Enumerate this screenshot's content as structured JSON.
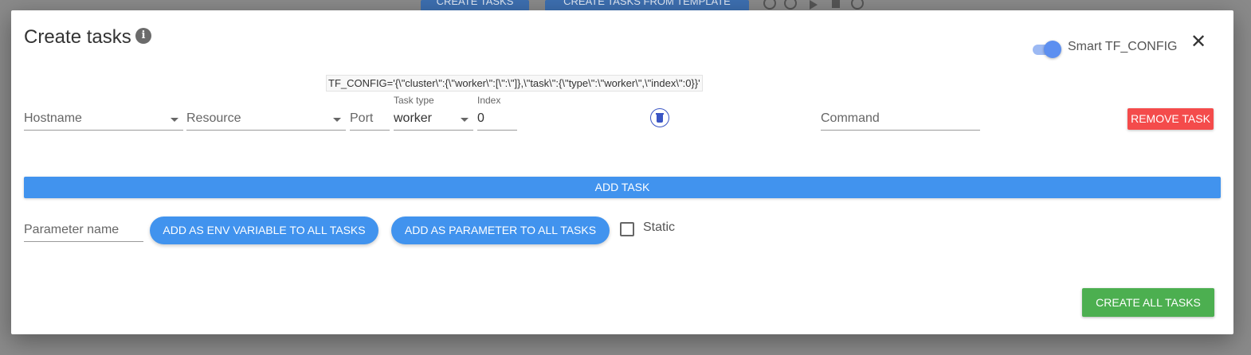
{
  "background": {
    "create_tasks_label": "CREATE TASKS",
    "create_from_template_label": "CREATE TASKS FROM TEMPLATE"
  },
  "modal": {
    "title": "Create tasks",
    "info_icon": "info-icon",
    "smart_tf_config_label": "Smart TF_CONFIG",
    "smart_tf_config_enabled": true,
    "close_glyph": "✕",
    "tf_config_preview": "TF_CONFIG='{\\\"cluster\\\":{\\\"worker\\\":[\\\":\\\"]},\\\"task\\\":{\\\"type\\\":\\\"worker\\\",\\\"index\\\":0}}'",
    "task": {
      "hostname_placeholder": "Hostname",
      "resource_placeholder": "Resource",
      "port_placeholder": "Port",
      "task_type_label": "Task type",
      "task_type_value": "worker",
      "index_label": "Index",
      "index_value": "0",
      "command_placeholder": "Command",
      "remove_label": "REMOVE TASK"
    },
    "add_task_label": "ADD TASK",
    "parameter": {
      "name_placeholder": "Parameter name",
      "add_env_label": "ADD AS ENV VARIABLE TO ALL TASKS",
      "add_param_label": "ADD AS PARAMETER TO ALL TASKS",
      "static_label": "Static",
      "static_checked": false
    },
    "create_all_label": "CREATE ALL TASKS"
  },
  "colors": {
    "primary": "#4193ee",
    "danger": "#f44b4b",
    "success": "#4caf50"
  }
}
